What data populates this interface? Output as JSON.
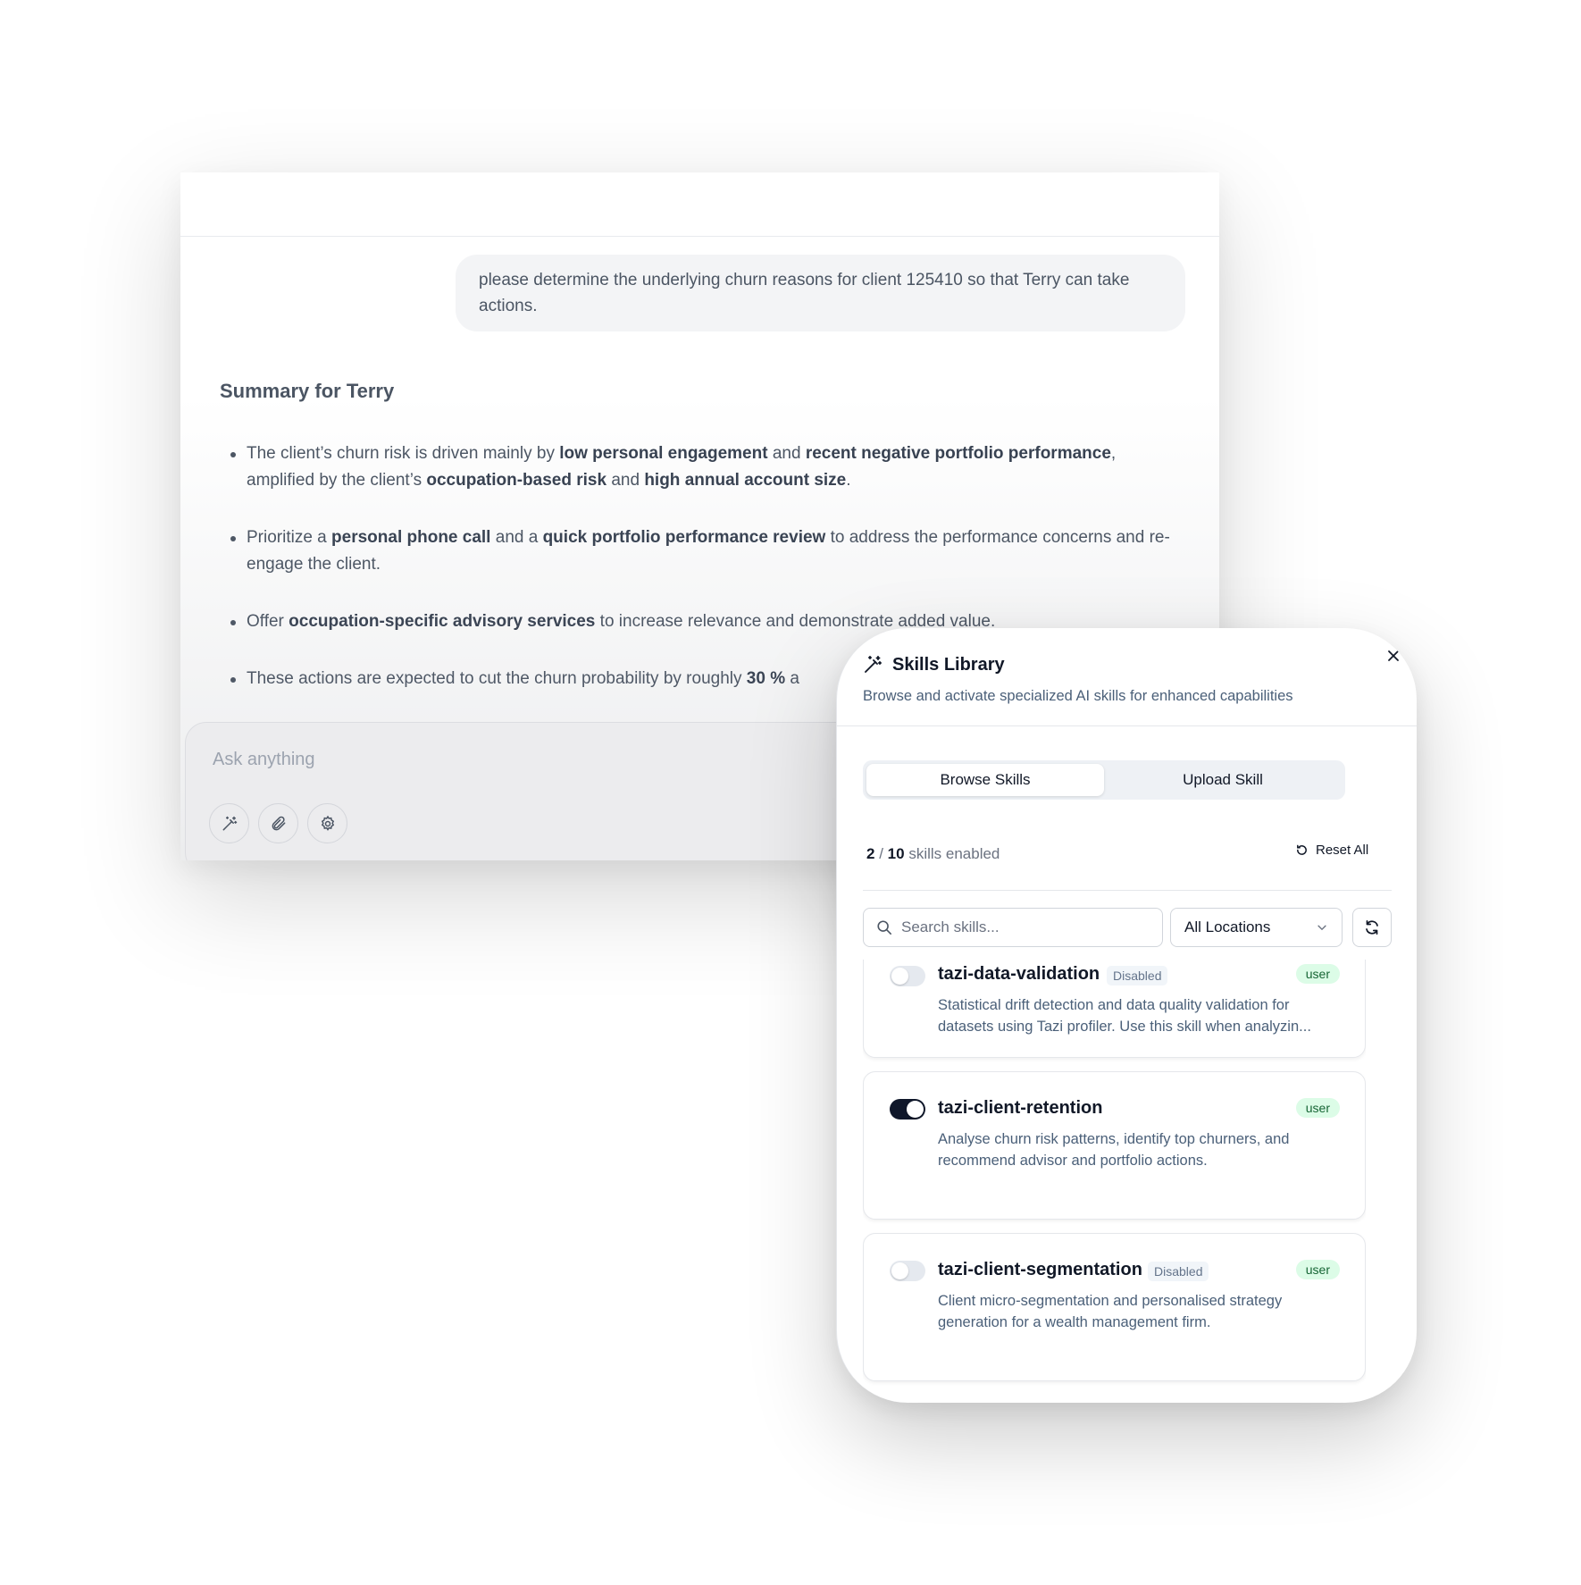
{
  "chat": {
    "user_message": "please determine the underlying churn reasons for client 125410 so that Terry can take actions.",
    "summary_title": "Summary for Terry",
    "bullets": {
      "b1": {
        "t1": "The client’s churn risk is driven mainly by ",
        "s1": "low personal engagement",
        "t2": " and ",
        "s2": "recent negative portfolio performance",
        "t3": ", amplified by the client’s ",
        "s3": "occupation-based risk",
        "t4": " and ",
        "s4": "high annual account size",
        "t5": "."
      },
      "b2": {
        "t1": "Prioritize a ",
        "s1": "personal phone call",
        "t2": " and a ",
        "s2": "quick portfolio performance review",
        "t3": " to address the performance concerns and re-engage the client."
      },
      "b3": {
        "t1": "Offer ",
        "s1": "occupation-specific advisory services",
        "t2": " to increase relevance and demonstrate added value."
      },
      "b4": {
        "t1": "These actions are expected to cut the churn probability by roughly ",
        "s1": "30 %",
        "t2": " a"
      }
    },
    "composer_placeholder": "Ask anything",
    "tool_icons": [
      "wand-icon",
      "paperclip-icon",
      "gear-icon"
    ]
  },
  "skills_panel": {
    "title": "Skills Library",
    "subtitle": "Browse and activate specialized AI skills for enhanced capabilities",
    "tabs": [
      "Browse Skills",
      "Upload Skill"
    ],
    "active_tab": "Browse Skills",
    "enabled_count": "2",
    "separator": "/",
    "total_count": "10",
    "enabled_suffix": "skills enabled",
    "reset_label": "Reset All",
    "search_placeholder": "Search skills...",
    "location_filter": "All Locations",
    "skills": [
      {
        "name": "tazi-data-validation",
        "enabled": false,
        "status_badge": "Disabled",
        "source_badge": "user",
        "description": "Statistical drift detection and data quality validation for datasets using Tazi profiler. Use this skill when analyzin..."
      },
      {
        "name": "tazi-client-retention",
        "enabled": true,
        "status_badge": "",
        "source_badge": "user",
        "description": "Analyse churn risk patterns, identify top churners, and recommend advisor and portfolio actions."
      },
      {
        "name": "tazi-client-segmentation",
        "enabled": false,
        "status_badge": "Disabled",
        "source_badge": "user",
        "description": "Client micro-segmentation and personalised strategy generation for a wealth management firm."
      }
    ],
    "colors": {
      "toggle_on": "#0f172a",
      "toggle_off": "#e5e9ef",
      "user_badge_bg": "#dcfce7",
      "user_badge_text": "#166534",
      "subtitle_text": "#4b6079"
    }
  }
}
